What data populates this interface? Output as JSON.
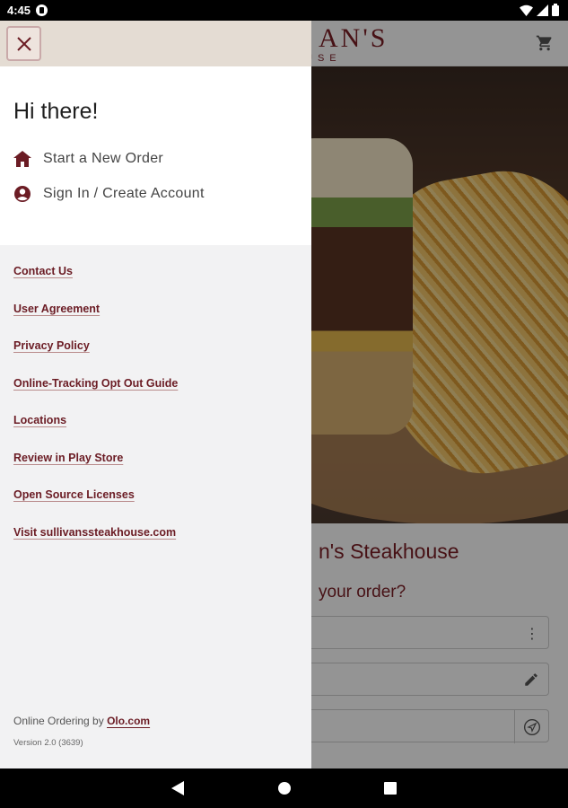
{
  "status_bar": {
    "time": "4:45"
  },
  "app": {
    "logo_main": "AN'S",
    "logo_sub": "USE",
    "restaurant_title": "n's Steakhouse",
    "order_question": "your order?"
  },
  "drawer": {
    "greeting": "Hi there!",
    "nav": [
      {
        "label": "Start a New Order",
        "icon": "home-icon"
      },
      {
        "label": "Sign In / Create Account",
        "icon": "account-circle-icon"
      }
    ],
    "links": [
      "Contact Us",
      "User Agreement",
      "Privacy Policy",
      "Online-Tracking Opt Out Guide",
      "Locations",
      "Review in Play Store",
      "Open Source Licenses",
      "Visit sullivanssteakhouse.com"
    ],
    "footer": {
      "powered_prefix": "Online Ordering by ",
      "powered_link": "Olo.com",
      "version": "Version 2.0 (3639)"
    }
  },
  "colors": {
    "brand": "#6b1c24",
    "drawer_header": "#e4dcd3"
  }
}
